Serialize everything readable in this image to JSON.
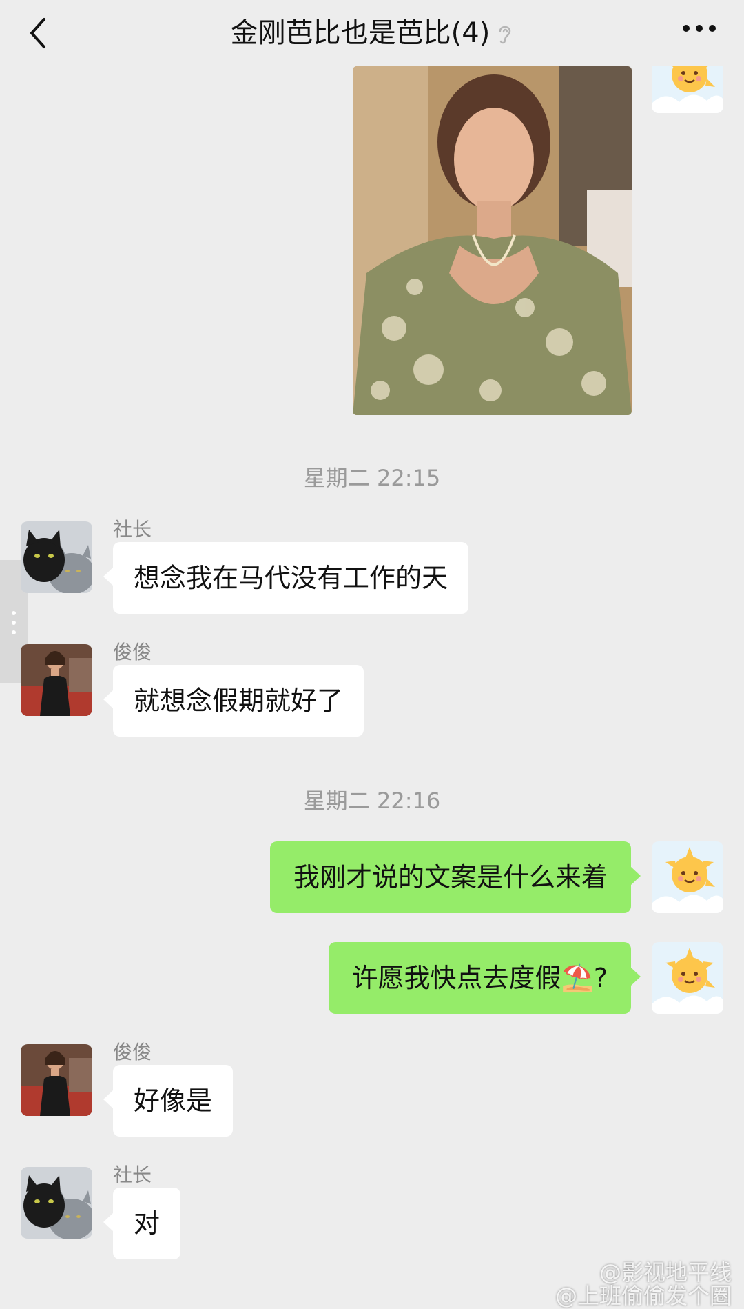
{
  "header": {
    "title": "金刚芭比也是芭比(4)",
    "back_icon": "chevron-left-icon",
    "mute_icon": "ear-muted-icon",
    "more_icon": "more-horizontal-icon"
  },
  "timestamps": [
    "星期二 22:15",
    "星期二 22:16"
  ],
  "messages": [
    {
      "sender": "社长",
      "text": "想念我在马代没有工作的天"
    },
    {
      "sender": "俊俊",
      "text": "就想念假期就好了"
    },
    {
      "sender": "me",
      "text": "我刚才说的文案是什么来着"
    },
    {
      "sender": "me",
      "text": "许愿我快点去度假⛱️?"
    },
    {
      "sender": "俊俊",
      "text": "好像是"
    },
    {
      "sender": "社长",
      "text": "对"
    }
  ],
  "watermark": {
    "line1": "@影视地平线",
    "line2": "@上班偷偷发个圈"
  },
  "colors": {
    "background": "#ededed",
    "outgoing_bubble": "#95ec69",
    "incoming_bubble": "#ffffff"
  }
}
